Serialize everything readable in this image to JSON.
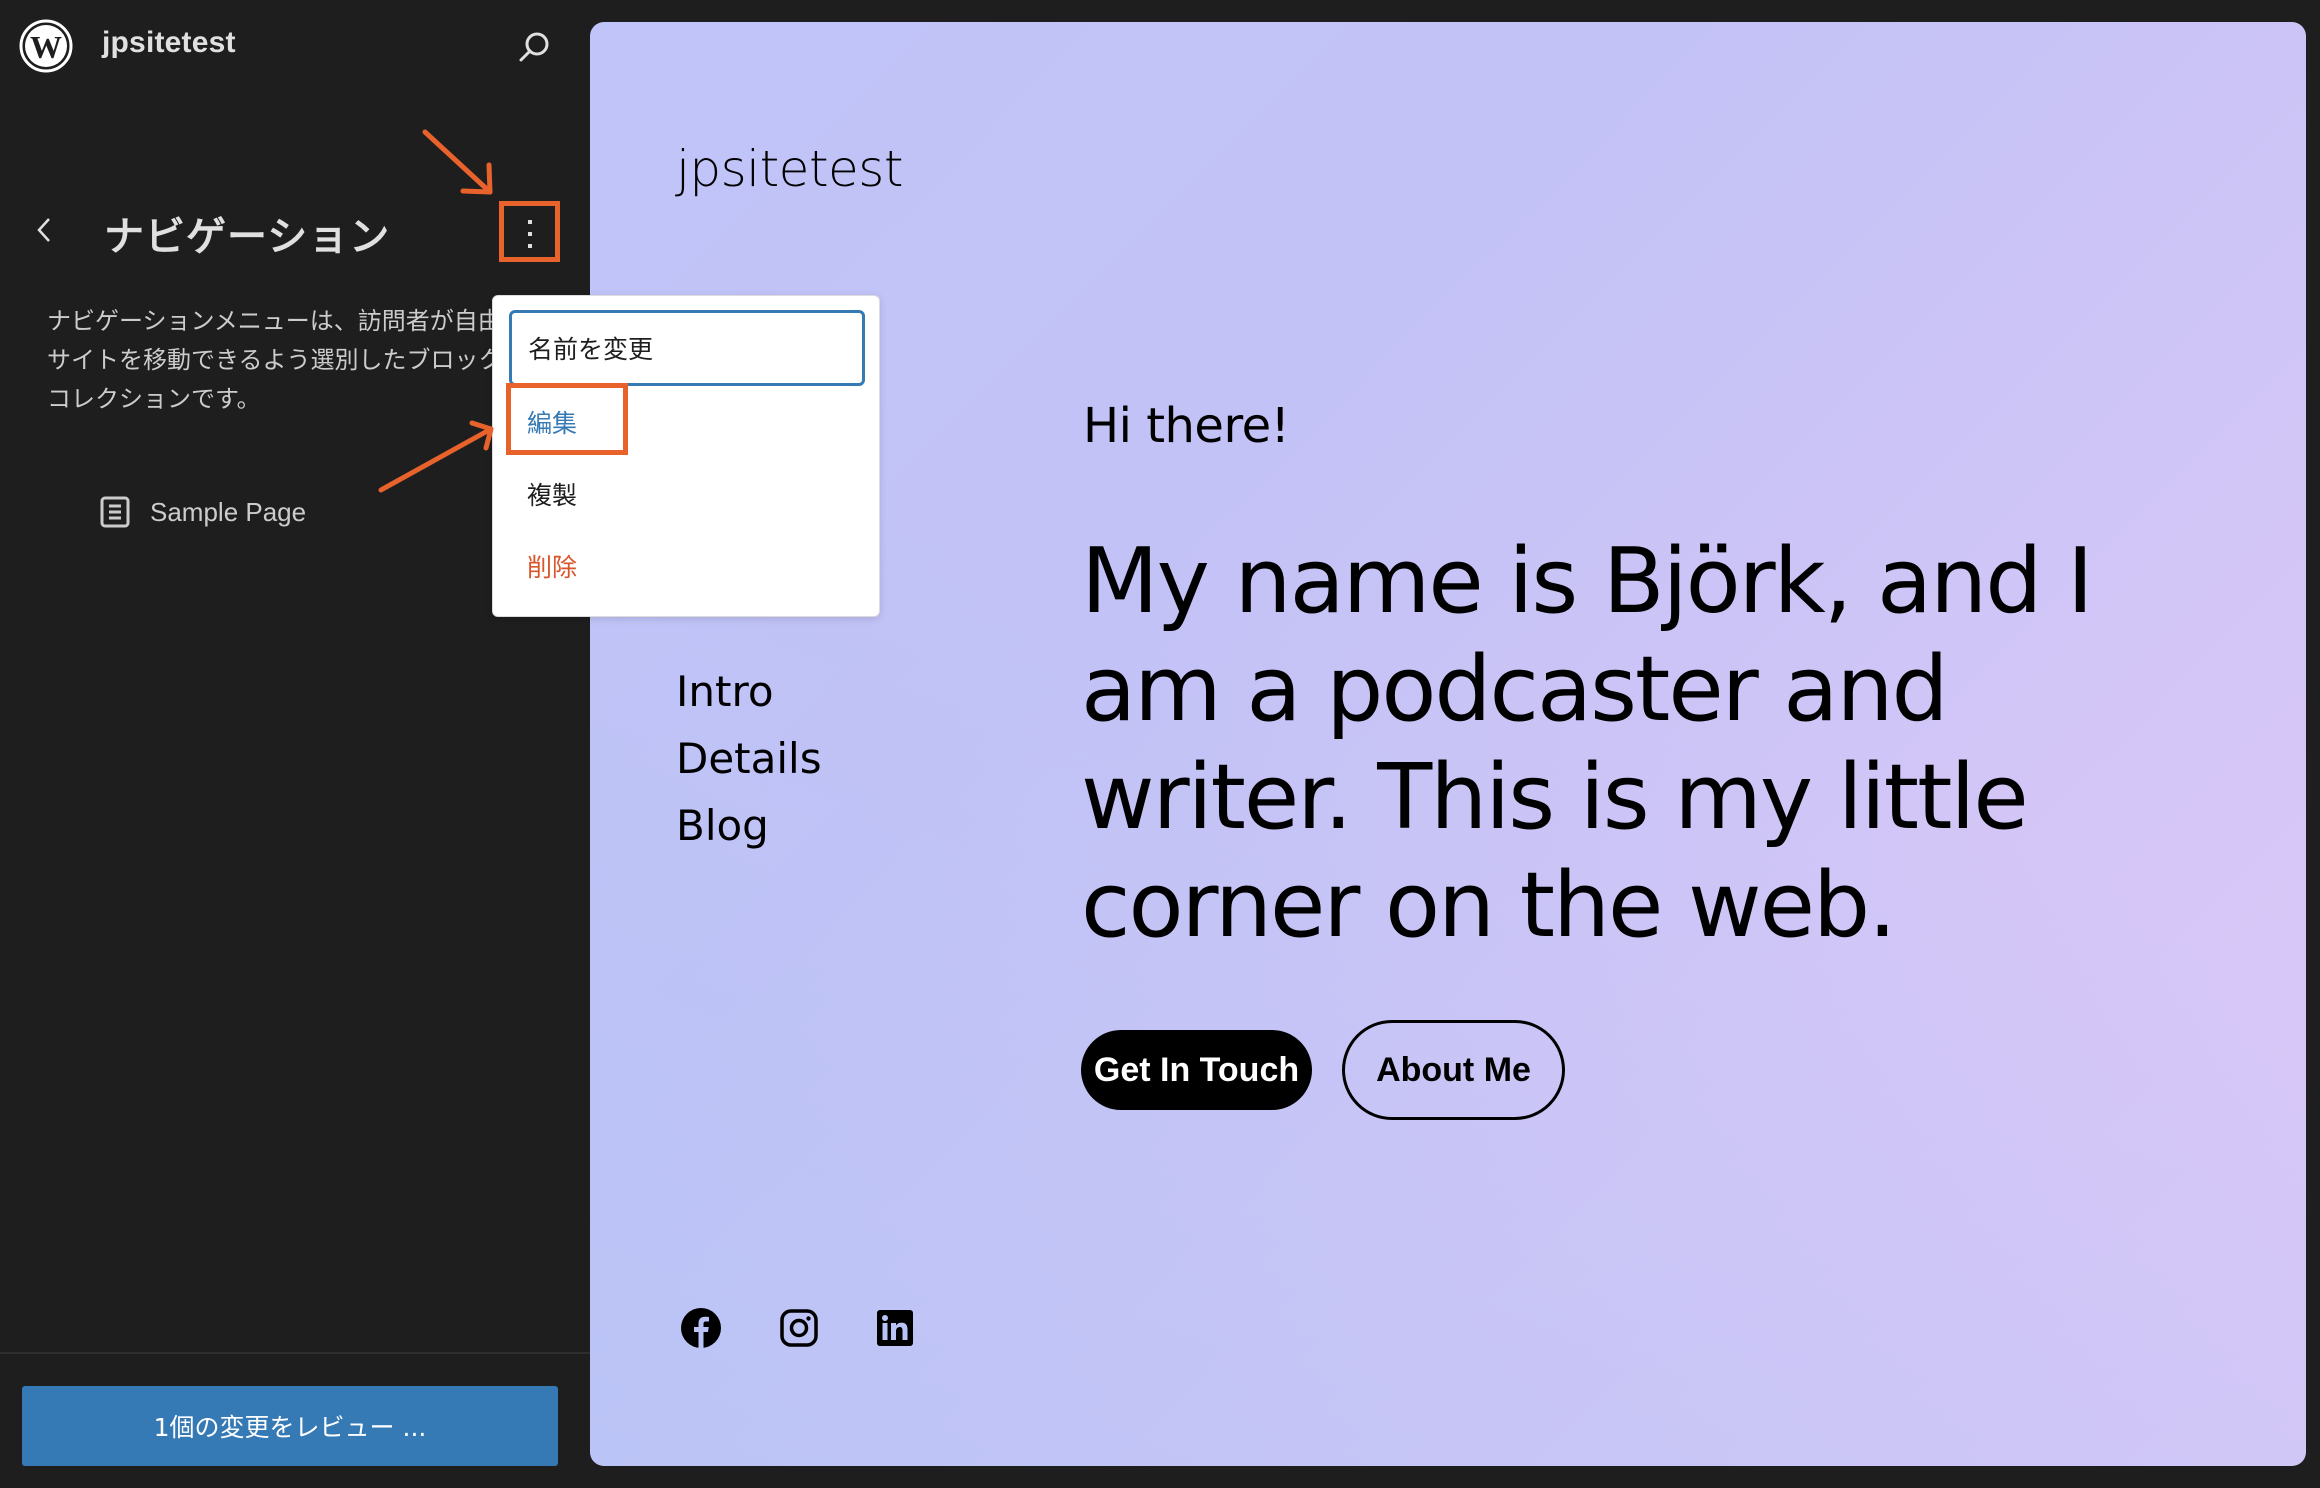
{
  "sidebar": {
    "site_name": "jpsitetest",
    "logo_icon": "wordpress-logo-icon",
    "search_icon": "search-icon",
    "back_icon": "chevron-left-icon",
    "panel_title": "ナビゲーション",
    "more_icon": "more-vertical-icon",
    "description": "ナビゲーションメニューは、訪問者が自由にサイトを移動できるよう選別したブロックのコレクションです。",
    "nav_items": [
      {
        "icon": "page-icon",
        "label": "Sample Page"
      }
    ],
    "review_button_label": "1個の変更をレビュー ..."
  },
  "menu": {
    "items": [
      {
        "label": "名前を変更",
        "state": "focused"
      },
      {
        "label": "編集",
        "state": "highlighted"
      },
      {
        "label": "複製",
        "state": "default"
      },
      {
        "label": "削除",
        "state": "destructive"
      }
    ]
  },
  "preview": {
    "site_title": "jpsitetest",
    "nav_links": [
      "Intro",
      "Details",
      "Blog"
    ],
    "greeting": "Hi there!",
    "heading": "My name is Björk, and I am a podcaster and writer. This is my little corner on the web.",
    "buttons": {
      "primary": "Get In Touch",
      "secondary": "About Me"
    },
    "social_icons": [
      "facebook-icon",
      "instagram-icon",
      "linkedin-icon"
    ]
  },
  "colors": {
    "sidebar_bg": "#1e1e1e",
    "accent": "#3579b5",
    "destructive": "#d9552b",
    "annotation": "#e8622c",
    "gradient_start": "#b5c1f5",
    "gradient_end": "#dcc8f8"
  }
}
